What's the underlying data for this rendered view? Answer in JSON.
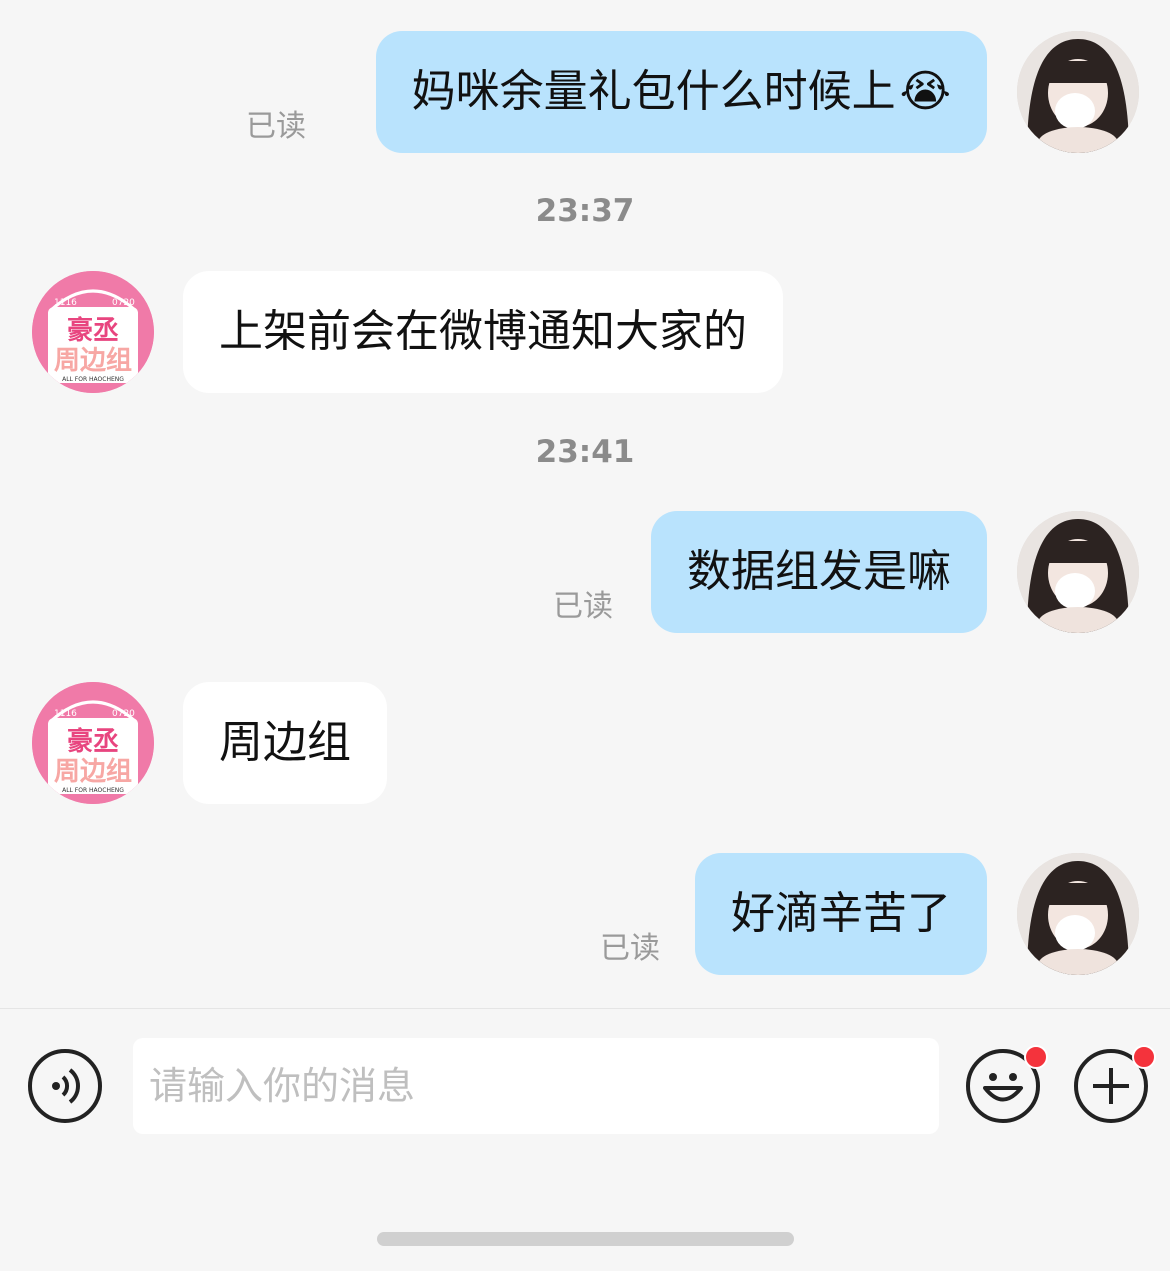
{
  "messages": [
    {
      "side": "me",
      "text": "妈咪余量礼包什么时候上",
      "emoji": "😭",
      "status": "已读"
    },
    {
      "side": "timestamp",
      "text": "23:37"
    },
    {
      "side": "them",
      "text": "上架前会在微博通知大家的"
    },
    {
      "side": "timestamp",
      "text": "23:41"
    },
    {
      "side": "me",
      "text": "数据组发是嘛",
      "status": "已读"
    },
    {
      "side": "them",
      "text": "周边组"
    },
    {
      "side": "me",
      "text": "好滴辛苦了",
      "status": "已读"
    }
  ],
  "them_avatar": {
    "top_left": "1116",
    "top_right": "0720",
    "line1": "豪丞",
    "line2": "周边组",
    "tagline": "ALL FOR HAOCHENG"
  },
  "input": {
    "placeholder": "请输入你的消息"
  },
  "icons": {
    "voice": "voice-icon",
    "emoji": "emoji-icon",
    "plus": "plus-icon"
  },
  "colors": {
    "my_bubble": "#b9e3fd",
    "their_bubble": "#ffffff",
    "background": "#f6f6f6",
    "badge": "#f4333c",
    "brand_pink": "#f07aa8"
  }
}
